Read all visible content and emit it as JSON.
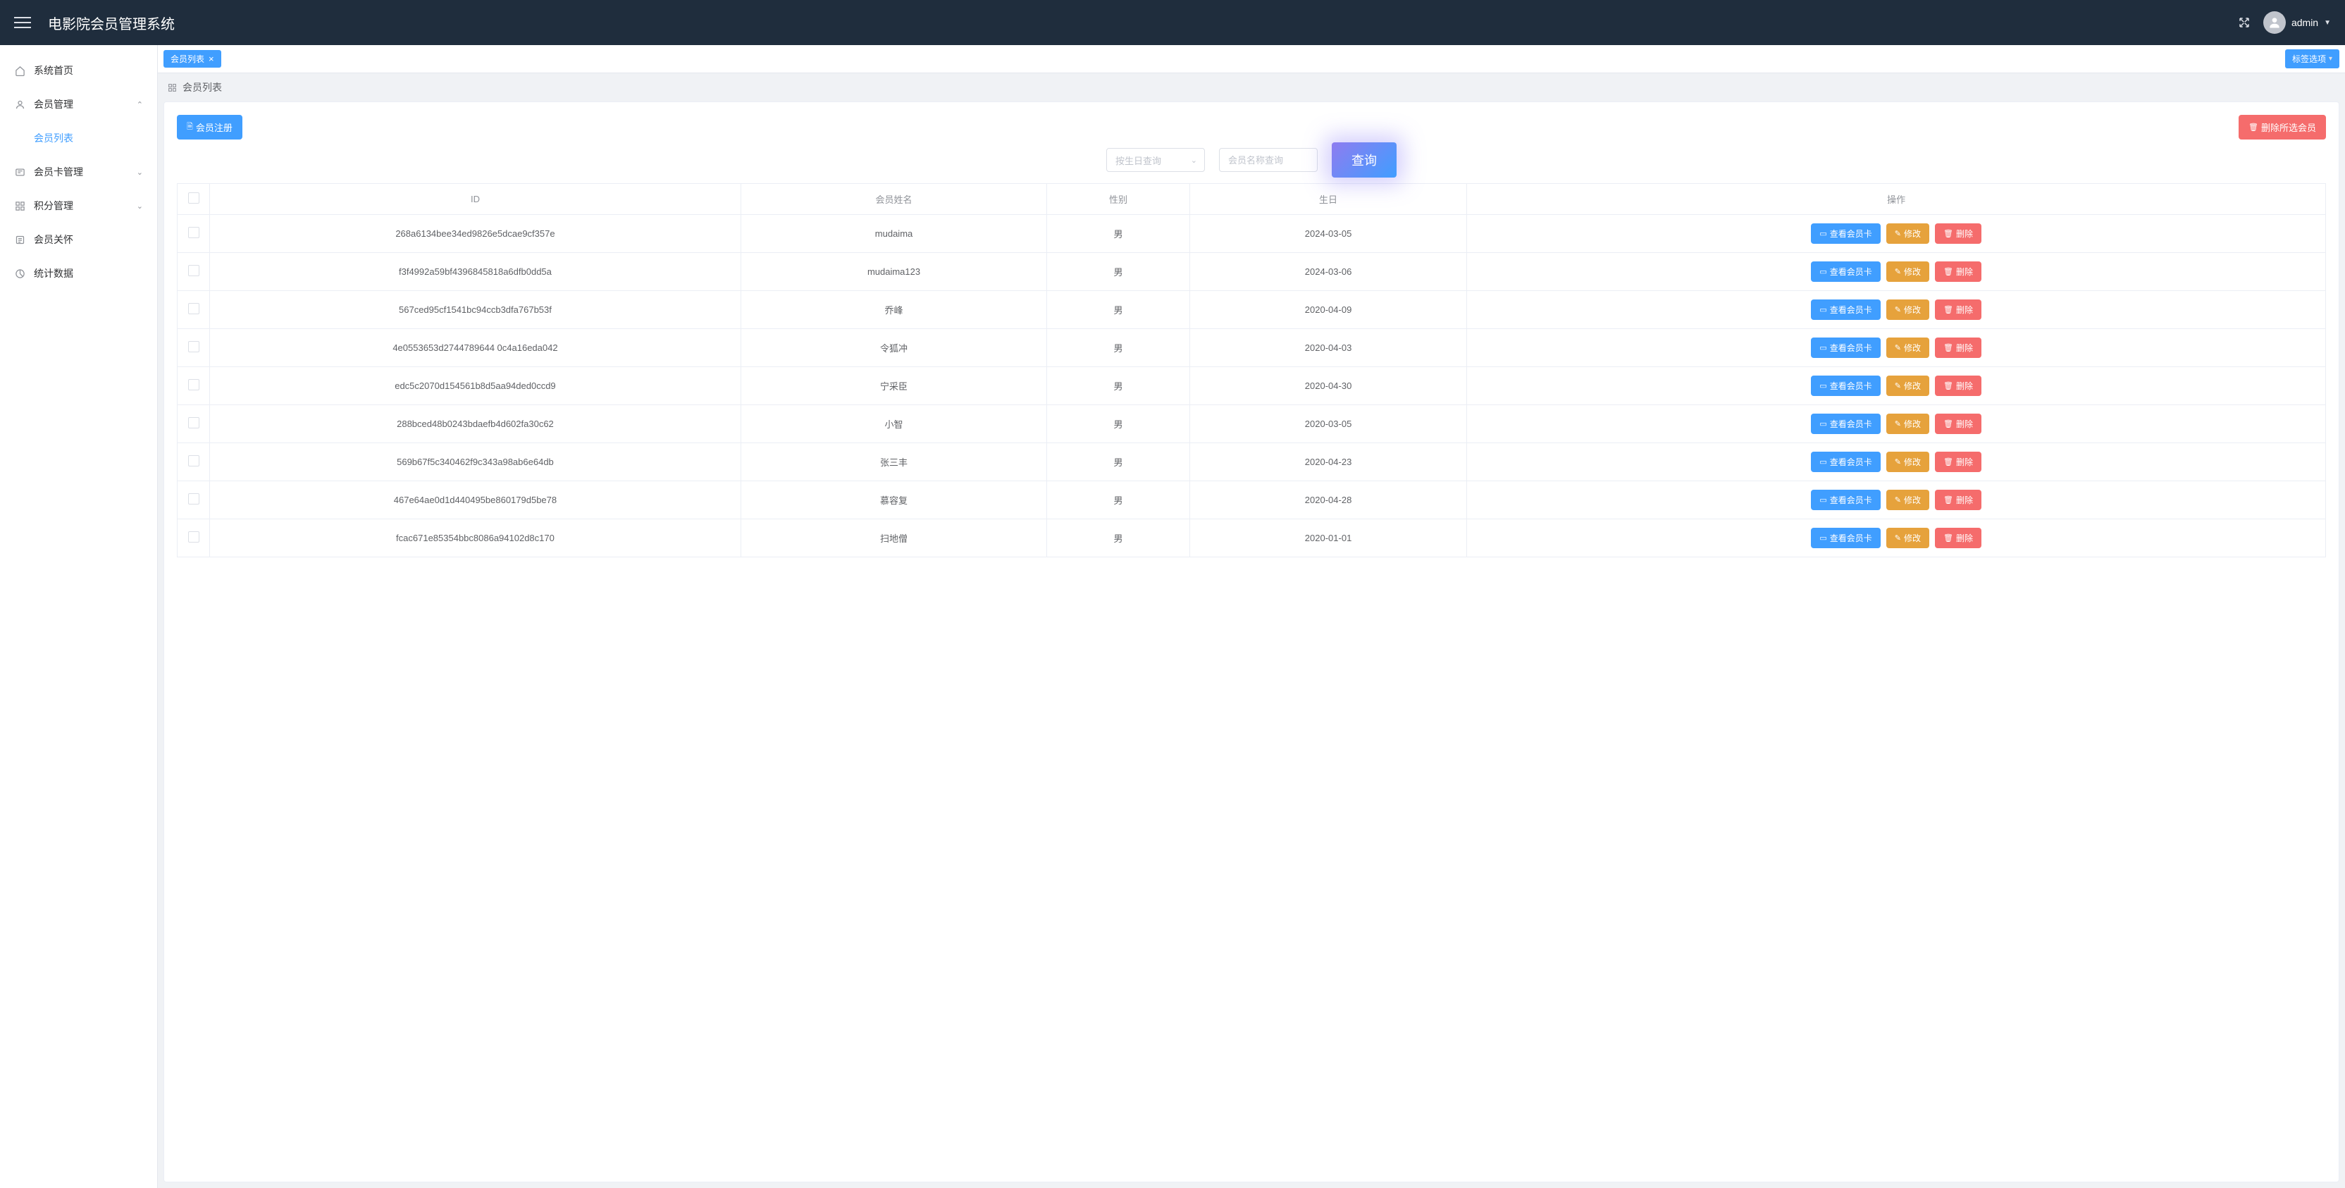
{
  "header": {
    "title": "电影院会员管理系统",
    "username": "admin"
  },
  "sidebar": {
    "items": [
      {
        "label": "系统首页",
        "icon": "home"
      },
      {
        "label": "会员管理",
        "icon": "user",
        "expanded": true,
        "children": [
          {
            "label": "会员列表",
            "active": true
          }
        ]
      },
      {
        "label": "会员卡管理",
        "icon": "card",
        "expanded": false
      },
      {
        "label": "积分管理",
        "icon": "grid",
        "expanded": false
      },
      {
        "label": "会员关怀",
        "icon": "list"
      },
      {
        "label": "统计数据",
        "icon": "chart"
      }
    ]
  },
  "tabs": {
    "active": "会员列表",
    "options_label": "标签选项"
  },
  "breadcrumb": {
    "title": "会员列表"
  },
  "toolbar": {
    "register_label": "会员注册",
    "delete_selected_label": "删除所选会员"
  },
  "filters": {
    "birthday_placeholder": "按生日查询",
    "name_placeholder": "会员名称查询",
    "search_label": "查询"
  },
  "table": {
    "headers": {
      "id": "ID",
      "name": "会员姓名",
      "gender": "性别",
      "birthday": "生日",
      "action": "操作"
    },
    "action_labels": {
      "view_card": "查看会员卡",
      "edit": "修改",
      "delete": "删除"
    },
    "rows": [
      {
        "id": "268a6134bee34ed9826e5dcae9cf357e",
        "name": "mudaima",
        "gender": "男",
        "birthday": "2024-03-05"
      },
      {
        "id": "f3f4992a59bf4396845818a6dfb0dd5a",
        "name": "mudaima123",
        "gender": "男",
        "birthday": "2024-03-06"
      },
      {
        "id": "567ced95cf1541bc94ccb3dfa767b53f",
        "name": "乔峰",
        "gender": "男",
        "birthday": "2020-04-09"
      },
      {
        "id": "4e0553653d2744789644 0c4a16eda042",
        "name": "令狐冲",
        "gender": "男",
        "birthday": "2020-04-03"
      },
      {
        "id": "edc5c2070d154561b8d5aa94ded0ccd9",
        "name": "宁采臣",
        "gender": "男",
        "birthday": "2020-04-30"
      },
      {
        "id": "288bced48b0243bdaefb4d602fa30c62",
        "name": "小智",
        "gender": "男",
        "birthday": "2020-03-05"
      },
      {
        "id": "569b67f5c340462f9c343a98ab6e64db",
        "name": "张三丰",
        "gender": "男",
        "birthday": "2020-04-23"
      },
      {
        "id": "467e64ae0d1d440495be860179d5be78",
        "name": "慕容复",
        "gender": "男",
        "birthday": "2020-04-28"
      },
      {
        "id": "fcac671e85354bbc8086a94102d8c170",
        "name": "扫地僧",
        "gender": "男",
        "birthday": "2020-01-01"
      }
    ]
  }
}
